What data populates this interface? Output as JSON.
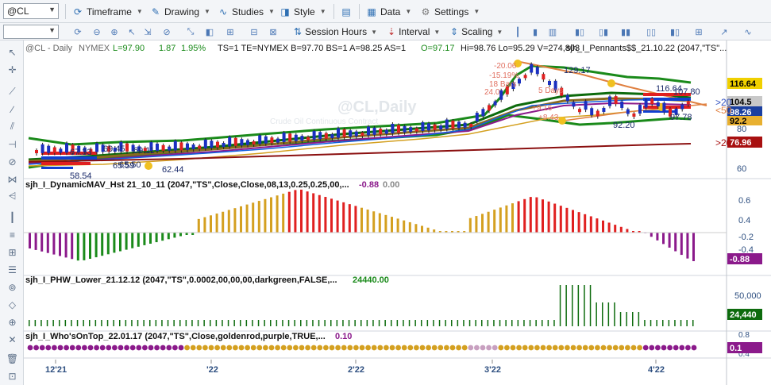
{
  "toolbar": {
    "symbol": "@CL",
    "interval_value": "",
    "menus": [
      "Timeframe",
      "Drawing",
      "Studies",
      "Style",
      "Data",
      "Settings"
    ],
    "menus2": [
      "Session Hours",
      "Interval",
      "Scaling"
    ]
  },
  "chart": {
    "header": {
      "symbol": "@CL - Daily",
      "exchange": "NYMEX",
      "last": "L=97.90",
      "change": "1.87",
      "change_pct": "1.95%",
      "rest": "TS=1  TE=NYMEX  B=97.70  BS=1  A=98.25  AS=1",
      "open": "O=97.17",
      "hilo": "Hi=98.76  Lo=95.29  V=274,803",
      "study": "sjh_I_Pennants$$_21.10.22 (2047,\"TS\"..."
    },
    "watermark": "@CL,Daily",
    "watermark_sub": "Crude Oil Continuous Contract",
    "price_labels": [
      "67.33",
      "69.45",
      "69.11",
      "58.54",
      "65.59",
      "65.50",
      "62.44",
      "129.17",
      "92.20",
      "97.78",
      "116.64",
      "107.80"
    ],
    "annotations": [
      "-20.06",
      "-15.19%",
      "18 Bars",
      "24.0",
      "+9.16",
      "+8.43",
      "5 Days"
    ],
    "axis_main": [
      "116.64",
      "104.5",
      "98.26",
      "92.2",
      "76.96",
      "60",
      "80"
    ],
    "axis_markers": [
      ">20",
      "<50",
      ">20"
    ],
    "panes": [
      {
        "title": "sjh_I_DynamicMAV_Hst 21_10_11 (2047,\"TS\",Close,Close,08,13,0.25,0.25,00,...",
        "v1": "-0.88",
        "v2": "0.00",
        "axis": [
          "0.6",
          "0.4",
          "-0.2",
          "-0.4"
        ],
        "last": "-0.88"
      },
      {
        "title": "sjh_I_PHW_Lower_21.12.12 (2047,\"TS\",0.0002,00,00,00,darkgreen,FALSE,...",
        "v1": "24440.00",
        "axis": [
          "50,000"
        ],
        "last": "24,440"
      },
      {
        "title": "sjh_I_Who'sOnTop_22.01.17 (2047,\"TS\",Close,goldenrod,purple,TRUE,...",
        "v1": "0.10",
        "axis": [
          "0.8",
          "0.4"
        ],
        "last": "0.1"
      }
    ],
    "x_labels": [
      "12'21",
      "'22",
      "2'22",
      "3'22",
      "4'22"
    ]
  },
  "colors": {
    "green": "#1a8a1a",
    "darkgreen": "#0d6b0d",
    "red": "#e02020",
    "goldenrod": "#d4a020",
    "purple": "#8b1a8b",
    "blue": "#1060e0",
    "orange": "#e08040",
    "darkred": "#8b1010"
  }
}
